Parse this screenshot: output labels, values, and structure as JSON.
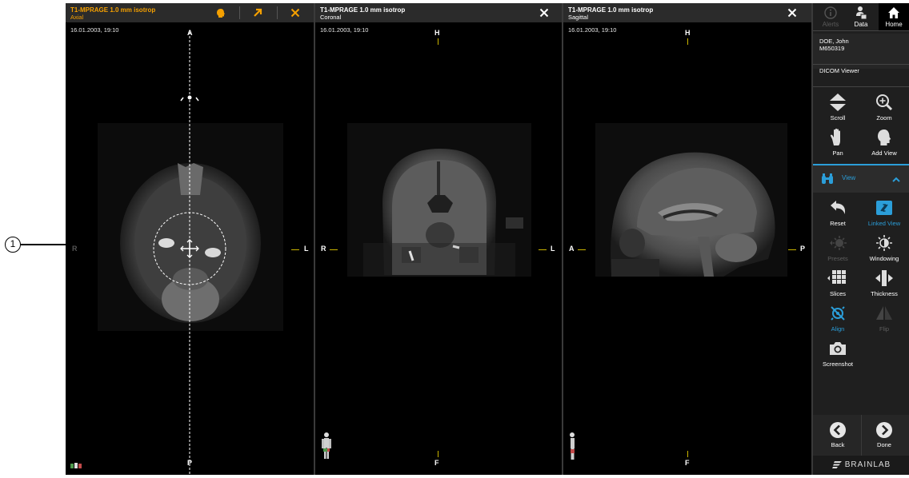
{
  "callout_number": "1",
  "viewers": [
    {
      "title": "T1-MPRAGE 1.0 mm isotrop",
      "plane": "Axial",
      "date": "16.01.2003, 19:10",
      "top": "A",
      "bottom": "P",
      "left": "R",
      "right": "L",
      "active": true
    },
    {
      "title": "T1-MPRAGE 1.0 mm isotrop",
      "plane": "Coronal",
      "date": "16.01.2003, 19:10",
      "top": "H",
      "bottom": "F",
      "left": "R",
      "right": "L"
    },
    {
      "title": "T1-MPRAGE 1.0 mm isotrop",
      "plane": "Sagittal",
      "date": "16.01.2003, 19:10",
      "top": "H",
      "bottom": "F",
      "left": "A",
      "right": "P"
    }
  ],
  "sidebar": {
    "tabs": [
      {
        "label": "Alerts",
        "icon": "info-icon",
        "state": "disabled"
      },
      {
        "label": "Data",
        "icon": "data-icon"
      },
      {
        "label": "Home",
        "icon": "home-icon",
        "state": "active"
      }
    ],
    "patient_name": "DOE, John",
    "patient_id": "M650319",
    "app_name": "DICOM Viewer",
    "tools_top": [
      {
        "label": "Scroll",
        "icon": "scroll-icon"
      },
      {
        "label": "Zoom",
        "icon": "zoom-icon"
      },
      {
        "label": "Pan",
        "icon": "pan-hand-icon"
      },
      {
        "label": "Add View",
        "icon": "add-view-head-icon"
      }
    ],
    "view_section": "View",
    "tools_view": [
      {
        "label": "Reset",
        "icon": "reset-icon"
      },
      {
        "label": "Linked View",
        "icon": "linked-view-icon",
        "state": "active"
      },
      {
        "label": "Presets",
        "icon": "presets-icon",
        "state": "disabled"
      },
      {
        "label": "Windowing",
        "icon": "windowing-icon"
      },
      {
        "label": "Slices",
        "icon": "slices-icon"
      },
      {
        "label": "Thickness",
        "icon": "thickness-icon"
      },
      {
        "label": "Align",
        "icon": "align-icon",
        "state": "active"
      },
      {
        "label": "Flip",
        "icon": "flip-icon",
        "state": "disabled"
      },
      {
        "label": "Screenshot",
        "icon": "camera-icon"
      }
    ],
    "back_label": "Back",
    "done_label": "Done",
    "brand": "BRAINLAB"
  },
  "colors": {
    "accent_orange": "#f5a000",
    "accent_blue": "#2b9ed9",
    "orientation_tick": "#c9b400"
  }
}
